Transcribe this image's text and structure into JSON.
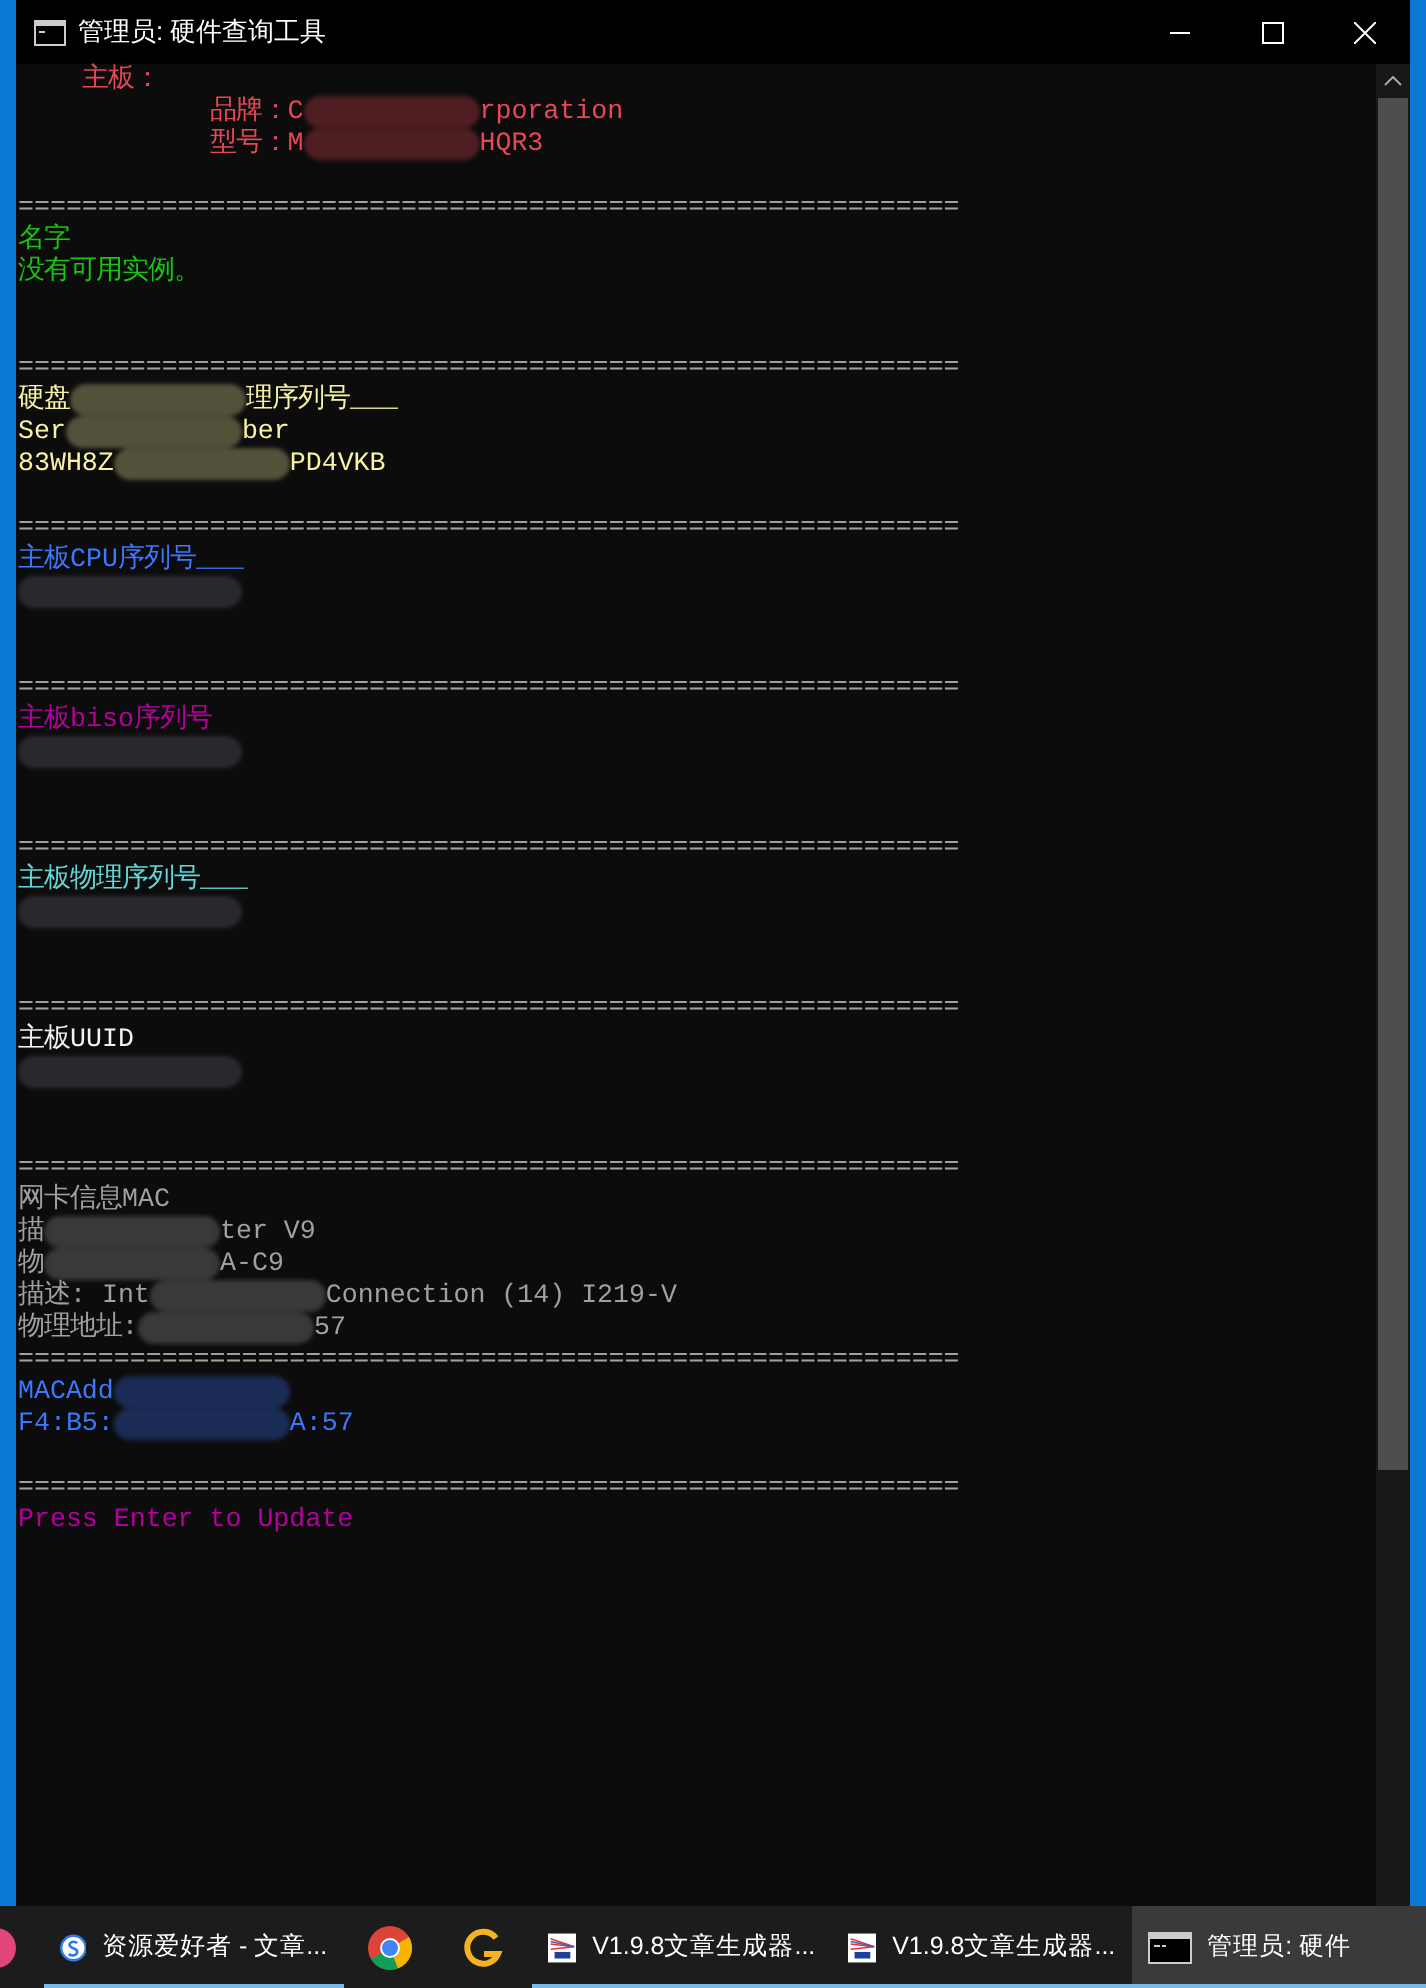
{
  "window": {
    "title": "管理员: 硬件查询工具"
  },
  "console": {
    "lines": [
      {
        "kind": "text",
        "color": "#e74856",
        "parts": [
          {
            "kind": "text",
            "text": "    主板："
          }
        ]
      },
      {
        "kind": "text",
        "color": "#e74856",
        "parts": [
          {
            "kind": "text",
            "text": "            品牌：C"
          },
          {
            "kind": "redacted"
          },
          {
            "kind": "text",
            "text": "rporation"
          }
        ]
      },
      {
        "kind": "text",
        "color": "#e74856",
        "parts": [
          {
            "kind": "text",
            "text": "            型号：M"
          },
          {
            "kind": "redacted"
          },
          {
            "kind": "text",
            "text": "HQR3"
          }
        ]
      },
      {
        "kind": "blank"
      },
      {
        "kind": "rule",
        "text": "==========================================================="
      },
      {
        "kind": "text",
        "color": "#16c60c",
        "parts": [
          {
            "kind": "text",
            "text": "名字"
          }
        ]
      },
      {
        "kind": "text",
        "color": "#16c60c",
        "parts": [
          {
            "kind": "text",
            "text": "没有可用实例。"
          }
        ]
      },
      {
        "kind": "blank"
      },
      {
        "kind": "blank"
      },
      {
        "kind": "rule",
        "text": "==========================================================="
      },
      {
        "kind": "text",
        "color": "#f9f1a5",
        "parts": [
          {
            "kind": "text",
            "text": "硬盘"
          },
          {
            "kind": "redacted"
          },
          {
            "kind": "text",
            "text": "理序列号___"
          }
        ]
      },
      {
        "kind": "text",
        "color": "#f9f1a5",
        "parts": [
          {
            "kind": "text",
            "text": "Ser"
          },
          {
            "kind": "redacted"
          },
          {
            "kind": "text",
            "text": "ber"
          }
        ]
      },
      {
        "kind": "text",
        "color": "#f9f1a5",
        "parts": [
          {
            "kind": "text",
            "text": "83WH8Z"
          },
          {
            "kind": "redacted"
          },
          {
            "kind": "text",
            "text": "PD4VKB"
          }
        ]
      },
      {
        "kind": "blank"
      },
      {
        "kind": "rule",
        "text": "==========================================================="
      },
      {
        "kind": "text",
        "color": "#3b78ff",
        "parts": [
          {
            "kind": "text",
            "text": "主板CPU序列号___"
          }
        ]
      },
      {
        "kind": "text",
        "parts": [
          {
            "kind": "redacted"
          }
        ]
      },
      {
        "kind": "blank"
      },
      {
        "kind": "blank"
      },
      {
        "kind": "rule",
        "text": "==========================================================="
      },
      {
        "kind": "text",
        "color": "#b4009e",
        "parts": [
          {
            "kind": "text",
            "text": "主板biso序列号"
          }
        ]
      },
      {
        "kind": "text",
        "parts": [
          {
            "kind": "redacted"
          }
        ]
      },
      {
        "kind": "blank"
      },
      {
        "kind": "blank"
      },
      {
        "kind": "rule",
        "text": "==========================================================="
      },
      {
        "kind": "text",
        "color": "#61d6d6",
        "parts": [
          {
            "kind": "text",
            "text": "主板物理序列号___"
          }
        ]
      },
      {
        "kind": "text",
        "parts": [
          {
            "kind": "redacted"
          }
        ]
      },
      {
        "kind": "blank"
      },
      {
        "kind": "blank"
      },
      {
        "kind": "rule",
        "text": "==========================================================="
      },
      {
        "kind": "text",
        "color": "#f2f2f2",
        "parts": [
          {
            "kind": "text",
            "text": "主板UUID"
          }
        ]
      },
      {
        "kind": "text",
        "parts": [
          {
            "kind": "redacted"
          }
        ]
      },
      {
        "kind": "blank"
      },
      {
        "kind": "blank"
      },
      {
        "kind": "rule",
        "text": "==========================================================="
      },
      {
        "kind": "text",
        "color": "#a0a0a0",
        "parts": [
          {
            "kind": "text",
            "text": "网卡信息MAC"
          }
        ]
      },
      {
        "kind": "text",
        "color": "#a0a0a0",
        "parts": [
          {
            "kind": "text",
            "text": "描"
          },
          {
            "kind": "redacted"
          },
          {
            "kind": "text",
            "text": "ter V9"
          }
        ]
      },
      {
        "kind": "text",
        "color": "#a0a0a0",
        "parts": [
          {
            "kind": "text",
            "text": "物"
          },
          {
            "kind": "redacted"
          },
          {
            "kind": "text",
            "text": "A-C9"
          }
        ]
      },
      {
        "kind": "text",
        "color": "#a0a0a0",
        "parts": [
          {
            "kind": "text",
            "text": "描述: Int"
          },
          {
            "kind": "redacted"
          },
          {
            "kind": "text",
            "text": "Connection (14) I219-V"
          }
        ]
      },
      {
        "kind": "text",
        "color": "#a0a0a0",
        "parts": [
          {
            "kind": "text",
            "text": "物理地址:"
          },
          {
            "kind": "redacted"
          },
          {
            "kind": "text",
            "text": "57"
          }
        ]
      },
      {
        "kind": "rule",
        "text": "==========================================================="
      },
      {
        "kind": "text",
        "color": "#3b78ff",
        "parts": [
          {
            "kind": "text",
            "text": "MACAdd"
          },
          {
            "kind": "redacted"
          }
        ]
      },
      {
        "kind": "text",
        "color": "#3b78ff",
        "parts": [
          {
            "kind": "text",
            "text": "F4:B5:"
          },
          {
            "kind": "redacted"
          },
          {
            "kind": "text",
            "text": "A:57"
          }
        ]
      },
      {
        "kind": "blank"
      },
      {
        "kind": "rule",
        "text": "==========================================================="
      },
      {
        "kind": "text",
        "color": "#b4009e",
        "parts": [
          {
            "kind": "text",
            "text": "Press Enter to Update"
          }
        ]
      }
    ]
  },
  "taskbar": {
    "items": [
      {
        "kind": "partial",
        "running": false,
        "active": false
      },
      {
        "kind": "sogou",
        "label": "资源爱好者 - 文章...",
        "running": true,
        "active": false
      },
      {
        "kind": "chrome",
        "running": false,
        "active": false
      },
      {
        "kind": "g",
        "running": false,
        "active": false
      },
      {
        "kind": "ac",
        "label": "V1.9.8文章生成器...",
        "running": true,
        "active": false
      },
      {
        "kind": "ac",
        "label": "V1.9.8文章生成器...",
        "running": true,
        "active": false
      },
      {
        "kind": "console",
        "label": "管理员: 硬件",
        "running": true,
        "active": true
      }
    ]
  }
}
